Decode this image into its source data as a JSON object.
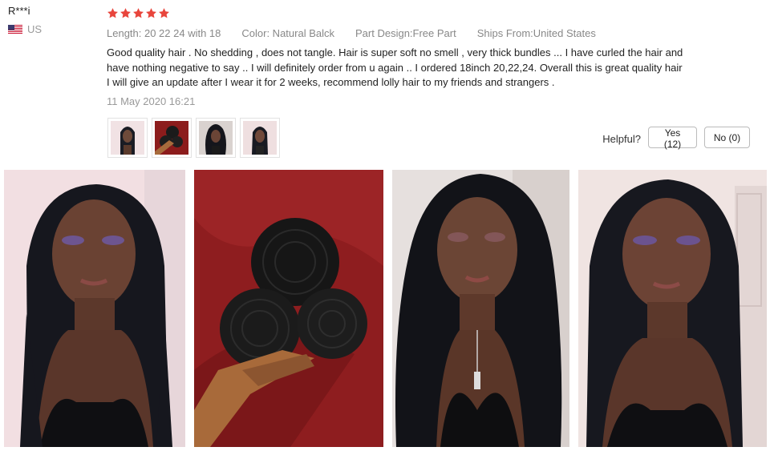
{
  "reviewer": {
    "name": "R***i",
    "country": "US",
    "flag_icon": "us-flag-icon"
  },
  "review": {
    "rating": 5,
    "star_color": "#e8453c",
    "attributes": {
      "length": "Length: 20 22 24 with 18",
      "color": "Color: Natural Balck",
      "part_design": "Part Design:Free Part",
      "ships_from": "Ships From:United States"
    },
    "text_lines": [
      "Good quality hair . No shedding , does not tangle. Hair is super soft no smell , very thick bundles ... I have curled the hair and",
      "have nothing negative to say .. I will definitely order from u again .. I ordered 18inch 20,22,24. Overall this is great quality hair",
      "I will give an update after I wear it for 2 weeks, recommend lolly hair to my friends and strangers ."
    ],
    "date": "11 May 2020 16:21"
  },
  "helpful": {
    "label": "Helpful?",
    "yes_label": "Yes (12)",
    "no_label": "No (0)"
  }
}
